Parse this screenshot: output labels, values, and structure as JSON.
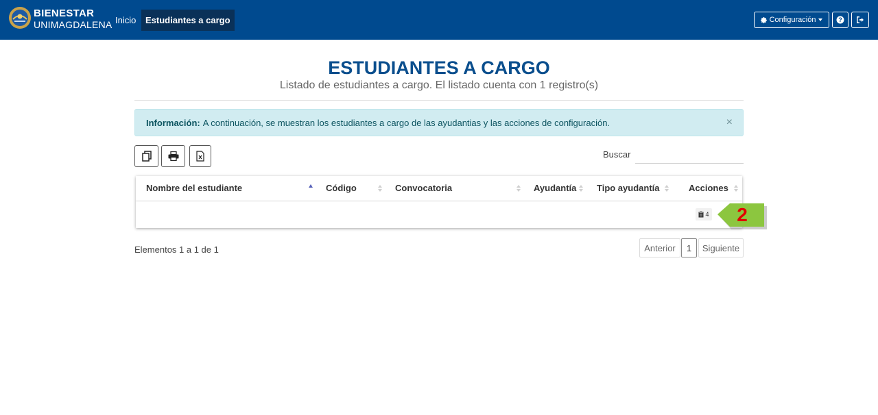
{
  "brand": {
    "line1": "BIENESTAR",
    "line2": "UNIMAGDALENA"
  },
  "nav": {
    "inicio": "Inicio",
    "estudiantes": "Estudiantes a cargo"
  },
  "header_buttons": {
    "config": "Configuración",
    "help_icon": "question-circle-icon",
    "logout_icon": "sign-out-icon"
  },
  "page": {
    "title": "ESTUDIANTES A CARGO",
    "subtitle": "Listado de estudiantes a cargo. El listado cuenta con 1 registro(s)"
  },
  "alert": {
    "label": "Información:",
    "text": "A continuación, se muestran los estudiantes a cargo de las ayudantias y las acciones de configuración.",
    "close": "×"
  },
  "toolbar": {
    "icons": [
      "copy-icon",
      "print-icon",
      "excel-icon"
    ]
  },
  "search": {
    "label": "Buscar",
    "value": ""
  },
  "table": {
    "columns": [
      "Nombre del estudiante",
      "Código",
      "Convocatoria",
      "Ayudantía",
      "Tipo ayudantía",
      "Acciones"
    ],
    "rows": [
      {
        "nombre": "",
        "codigo": "",
        "convocatoria": "",
        "ayudantia": "",
        "tipo": "",
        "accion_count": "4"
      }
    ]
  },
  "callout": {
    "number": "2"
  },
  "footer": {
    "info": "Elementos 1 a 1 de 1",
    "prev": "Anterior",
    "current_page": "1",
    "next": "Siguiente"
  },
  "colors": {
    "navbar": "#004a8f",
    "title": "#0a4e8d",
    "alert_bg": "#d1ecf1",
    "callout_green": "#8cc63f",
    "callout_number": "#e00000"
  }
}
